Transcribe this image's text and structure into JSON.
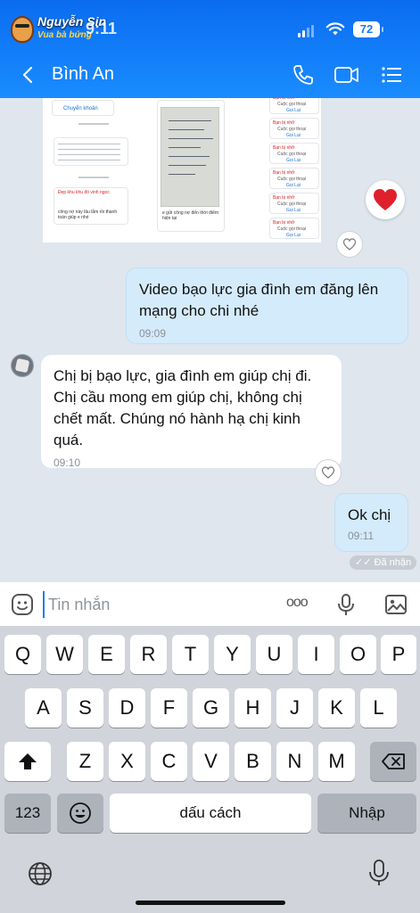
{
  "status": {
    "time": "9:11",
    "battery": "72",
    "watermark_title": "Nguyễn Sin",
    "watermark_subtitle": "Vua bà bứng"
  },
  "header": {
    "contact_name": "Bình An"
  },
  "shared_image": {
    "transfer_label": "Chuyển khoản",
    "note_line": "công nợ này lâu lắm rồi thanh toán giúp e nhé",
    "card_title": "Đẹp khu khu đó vinh ngọc",
    "paper_caption": "e gửi công nợ đến thời điểm hiện tại",
    "call_missed": "Bạn bị nhỡ",
    "call_voice": "Cuộc gọi thoại",
    "call_back": "Gọi Lại"
  },
  "messages": [
    {
      "sender": "me",
      "text": "Video bạo lực gia đình em đăng lên mạng cho chi nhé",
      "time": "09:09"
    },
    {
      "sender": "them",
      "text": "Chị bị bạo lực, gia đình em giúp chị đi. Chị cầu mong em giúp chị, không chị chết mất. Chúng nó hành hạ chị kinh quá.",
      "time": "09:10"
    },
    {
      "sender": "me",
      "text": "Ok chị",
      "time": "09:11"
    }
  ],
  "seen_status": "Đã nhận",
  "composer": {
    "placeholder": "Tin nhắn",
    "more_label": "ooo"
  },
  "keyboard": {
    "row1": [
      "Q",
      "W",
      "E",
      "R",
      "T",
      "Y",
      "U",
      "I",
      "O",
      "P"
    ],
    "row2": [
      "A",
      "S",
      "D",
      "F",
      "G",
      "H",
      "J",
      "K",
      "L"
    ],
    "row3": [
      "Z",
      "X",
      "C",
      "V",
      "B",
      "N",
      "M"
    ],
    "numbers_key": "123",
    "space_key": "dấu cách",
    "return_key": "Nhập"
  },
  "colors": {
    "header_blue": "#1a7cf0",
    "my_bubble": "#d4ebfb",
    "their_bubble": "#ffffff",
    "chat_background": "#dfe6ee",
    "heart_red": "#e0202c"
  }
}
